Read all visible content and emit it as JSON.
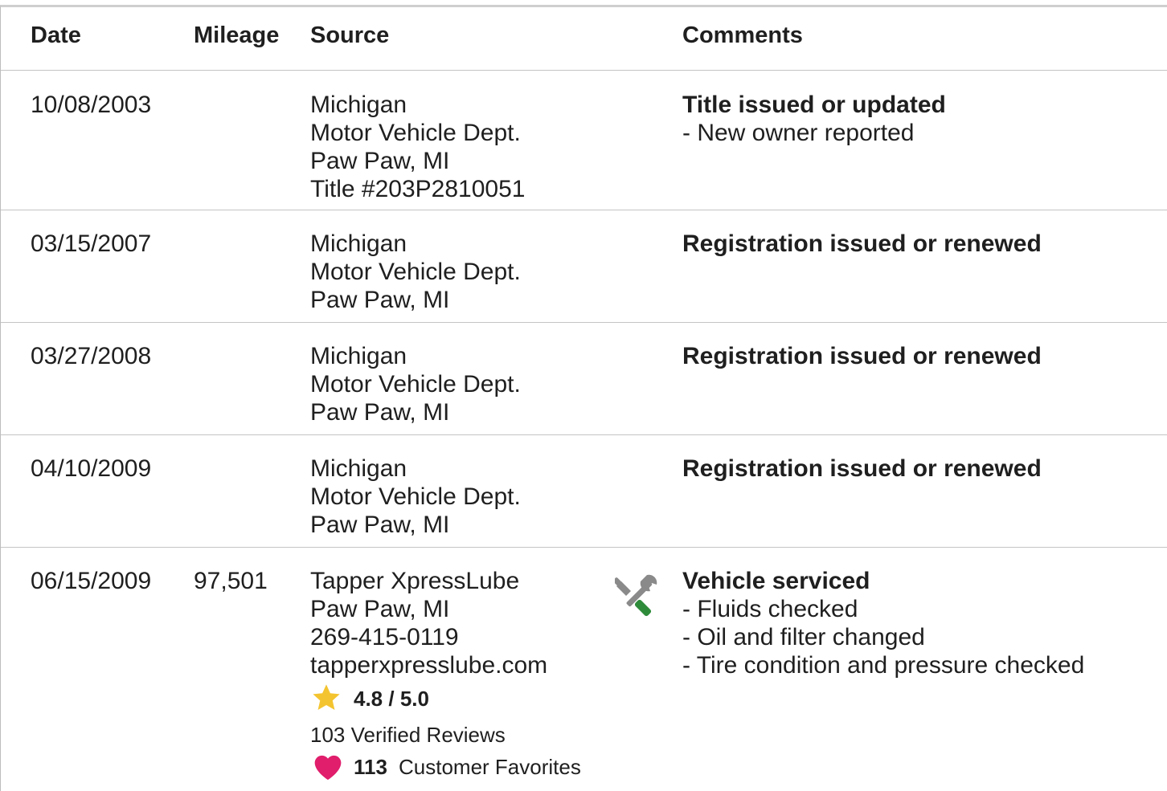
{
  "header": {
    "date": "Date",
    "mileage": "Mileage",
    "source": "Source",
    "comments": "Comments"
  },
  "rows": [
    {
      "date": "10/08/2003",
      "mileage": "",
      "source": [
        "Michigan",
        "Motor Vehicle Dept.",
        "Paw Paw, MI",
        "Title #203P2810051"
      ],
      "comment_title": "Title issued or updated",
      "comment_items": [
        "- New owner reported"
      ]
    },
    {
      "date": "03/15/2007",
      "mileage": "",
      "source": [
        "Michigan",
        "Motor Vehicle Dept.",
        "Paw Paw, MI"
      ],
      "comment_title": "Registration issued or renewed",
      "comment_items": []
    },
    {
      "date": "03/27/2008",
      "mileage": "",
      "source": [
        "Michigan",
        "Motor Vehicle Dept.",
        "Paw Paw, MI"
      ],
      "comment_title": "Registration issued or renewed",
      "comment_items": []
    },
    {
      "date": "04/10/2009",
      "mileage": "",
      "source": [
        "Michigan",
        "Motor Vehicle Dept.",
        "Paw Paw, MI"
      ],
      "comment_title": "Registration issued or renewed",
      "comment_items": []
    },
    {
      "date": "06/15/2009",
      "mileage": "97,501",
      "source": [
        "Tapper XpressLube",
        "Paw Paw, MI",
        "269-415-0119",
        "tapperxpresslube.com"
      ],
      "comment_title": "Vehicle serviced",
      "comment_items": [
        "- Fluids checked",
        "- Oil and filter changed",
        "- Tire condition and pressure checked"
      ],
      "rating": "4.8 / 5.0",
      "reviews": "103 Verified Reviews",
      "favorites_count": "113",
      "favorites_label": "Customer Favorites",
      "service_icon": "wrench-screwdriver-icon",
      "rating_icon": "star-icon",
      "favorites_icon": "heart-icon"
    }
  ],
  "colors": {
    "star": "#f4c430",
    "heart": "#e01e6b",
    "screwdriver": "#2e8b3a",
    "wrench": "#8a8a8a"
  }
}
